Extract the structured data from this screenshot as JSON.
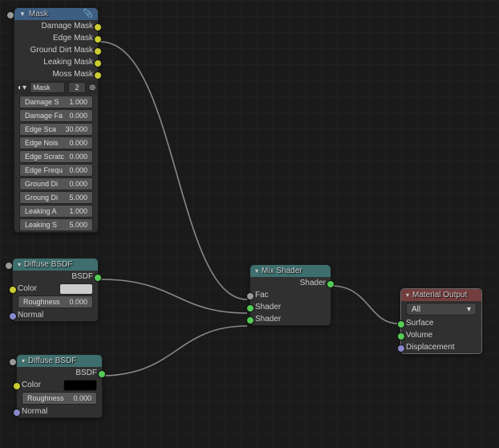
{
  "mask": {
    "title": "Mask",
    "group_name": "Mask",
    "users": "2",
    "outputs": [
      {
        "label": "Damage Mask"
      },
      {
        "label": "Edge Mask"
      },
      {
        "label": "Ground Dirt Mask"
      },
      {
        "label": "Leaking Mask"
      },
      {
        "label": "Moss Mask"
      }
    ],
    "inputs": [
      {
        "label": "Damage S",
        "val": "1.000"
      },
      {
        "label": "Damage Fa",
        "val": "0.000"
      },
      {
        "label": "Edge Sca",
        "val": "30.000"
      },
      {
        "label": "Edge Nois",
        "val": "0.000"
      },
      {
        "label": "Edge Scratc",
        "val": "0.000"
      },
      {
        "label": "Edge Frequ",
        "val": "0.000"
      },
      {
        "label": "Ground Di",
        "val": "0.000"
      },
      {
        "label": "Groung Di",
        "val": "5.000"
      },
      {
        "label": "Leaking A",
        "val": "1.000"
      },
      {
        "label": "Leaking S",
        "val": "5.000"
      }
    ]
  },
  "diffuse1": {
    "title": "Diffuse BSDF",
    "output": "BSDF",
    "color_label": "Color",
    "rough_label": "Roughness",
    "rough_val": "0.000",
    "normal_label": "Normal"
  },
  "diffuse2": {
    "title": "Diffuse BSDF",
    "output": "BSDF",
    "color_label": "Color",
    "rough_label": "Roughness",
    "rough_val": "0.000",
    "normal_label": "Normal"
  },
  "mix": {
    "title": "Mix Shader",
    "output": "Shader",
    "fac": "Fac",
    "shader1": "Shader",
    "shader2": "Shader"
  },
  "output": {
    "title": "Material Output",
    "target": "All",
    "surface": "Surface",
    "volume": "Volume",
    "displacement": "Displacement"
  }
}
